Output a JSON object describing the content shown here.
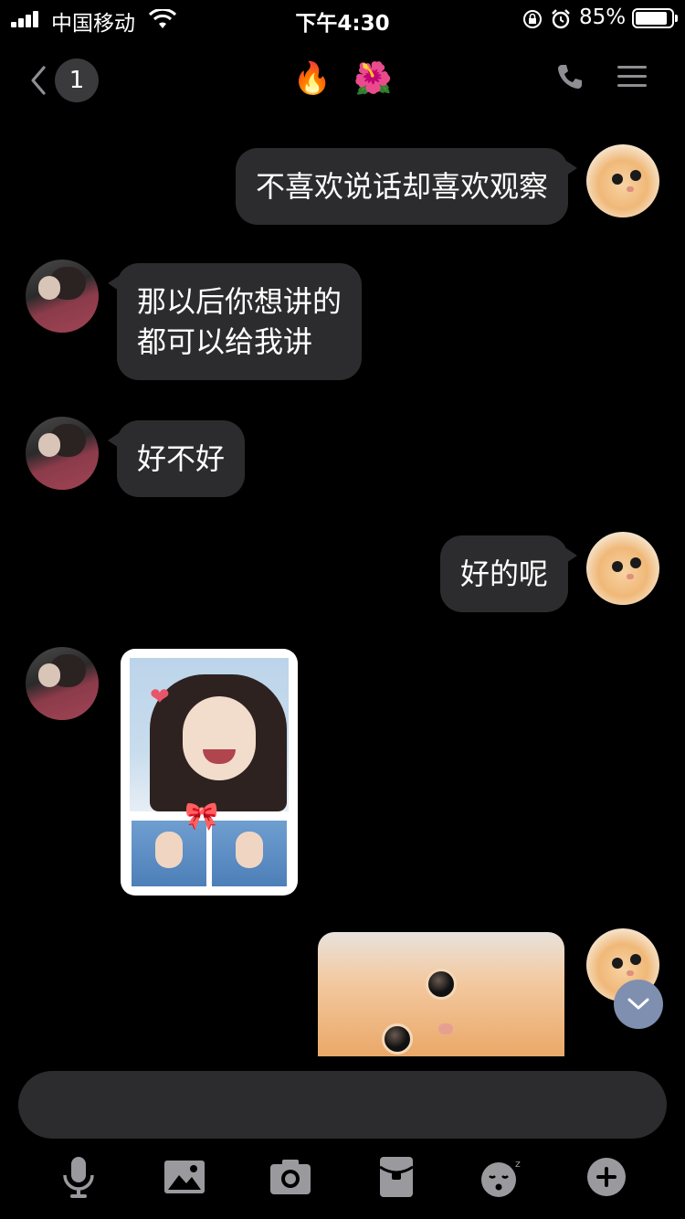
{
  "status_bar": {
    "carrier": "中国移动",
    "time": "下午4:30",
    "battery_percent": "85%",
    "icons": [
      "signal-icon",
      "wifi-icon",
      "orientation-lock-icon",
      "alarm-icon",
      "battery-icon"
    ]
  },
  "header": {
    "unread_count": "1",
    "title_emojis": [
      "🔥",
      "🌺"
    ],
    "icons": [
      "back-chevron-icon",
      "phone-icon",
      "menu-icon"
    ]
  },
  "messages": [
    {
      "sender": "me",
      "type": "text",
      "text": "不喜欢说话却喜欢观察"
    },
    {
      "sender": "other",
      "type": "text",
      "text": "那以后你想讲的\n都可以给我讲"
    },
    {
      "sender": "other",
      "type": "text",
      "text": "好不好"
    },
    {
      "sender": "me",
      "type": "text",
      "text": "好的呢"
    },
    {
      "sender": "other",
      "type": "sticker",
      "description_icon": "girl-thumbs-up-sticker"
    },
    {
      "sender": "me",
      "type": "image",
      "description_icon": "cat-photo"
    }
  ],
  "input": {
    "value": "",
    "placeholder": ""
  },
  "toolbar": {
    "items": [
      "microphone-icon",
      "image-icon",
      "camera-icon",
      "red-packet-icon",
      "emoji-icon",
      "plus-icon"
    ]
  },
  "colors": {
    "background": "#000000",
    "bubble": "#2c2c2e",
    "scroll_button": "#7f8fb0",
    "icon": "#9a9a9e"
  }
}
